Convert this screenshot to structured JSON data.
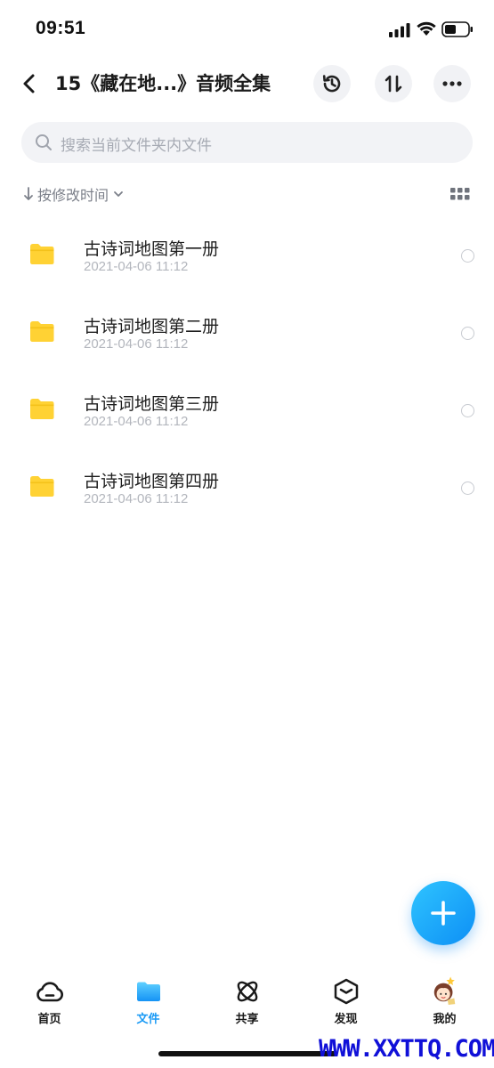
{
  "status_bar": {
    "time": "09:51"
  },
  "header": {
    "title": "15《藏在地...》音频全集"
  },
  "search": {
    "placeholder": "搜索当前文件夹内文件"
  },
  "sort": {
    "label": "按修改时间"
  },
  "files": [
    {
      "name": "古诗词地图第一册",
      "date": "2021-04-06 11:12"
    },
    {
      "name": "古诗词地图第二册",
      "date": "2021-04-06 11:12"
    },
    {
      "name": "古诗词地图第三册",
      "date": "2021-04-06 11:12"
    },
    {
      "name": "古诗词地图第四册",
      "date": "2021-04-06 11:12"
    }
  ],
  "tabs": [
    {
      "label": "首页",
      "icon": "cloud-icon"
    },
    {
      "label": "文件",
      "icon": "folder-icon",
      "active": true
    },
    {
      "label": "共享",
      "icon": "atom-icon"
    },
    {
      "label": "发现",
      "icon": "cube-icon"
    },
    {
      "label": "我的",
      "icon": "avatar-icon"
    }
  ],
  "watermark": "WWW.XXTTQ.COM",
  "colors": {
    "accent": "#1a9af5",
    "folder": "#ffd234",
    "fab_from": "#2fc4ff",
    "fab_to": "#0d8ff5"
  }
}
